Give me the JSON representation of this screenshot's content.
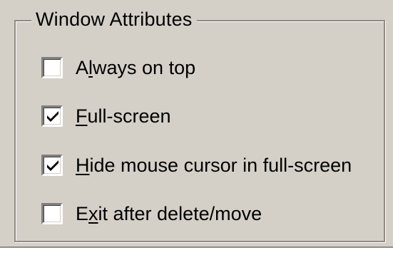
{
  "group": {
    "title": "Window Attributes"
  },
  "options": [
    {
      "label_prefix": "A",
      "label_mnemonic": "l",
      "label_rest": "ways on top",
      "checked": false
    },
    {
      "label_prefix": "",
      "label_mnemonic": "F",
      "label_rest": "ull-screen",
      "checked": true
    },
    {
      "label_prefix": "",
      "label_mnemonic": "H",
      "label_rest": "ide mouse cursor in full-screen",
      "checked": true
    },
    {
      "label_prefix": "E",
      "label_mnemonic": "x",
      "label_rest": "it after delete/move",
      "checked": false
    }
  ],
  "icons": {
    "check": "checkmark-icon"
  },
  "colors": {
    "face": "#d4d0c8",
    "shadow": "#808080",
    "highlight": "#ffffff",
    "text": "#000000"
  }
}
